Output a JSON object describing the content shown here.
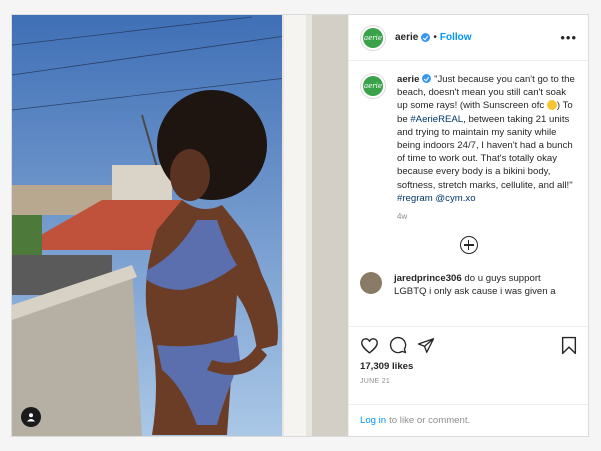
{
  "colors": {
    "accent": "#0095f6",
    "brand_green": "#3aa34a",
    "verified": "#3897f0"
  },
  "account": {
    "username": "aerie",
    "avatar_text": "aerie",
    "follow_label": "Follow",
    "separator": "•",
    "more_label": "•••"
  },
  "caption": {
    "username": "aerie",
    "part1": "\"Just because you can't go to the beach, doesn't mean you still can't soak up some rays! (with Sunscreen ofc ",
    "part2": ") To be ",
    "hashtag1": "#AerieREAL",
    "part3": ", between taking 21 units and trying to maintain my sanity while being indoors 24/7, I haven't had a bunch of time to work out. That's totally okay because every body is a bikini body, softness, stretch marks, cellulite, and all!\" ",
    "hashtag2": "#regram",
    "mention": "@cym.xo",
    "time_ago": "4w"
  },
  "comment": {
    "username": "jaredprince306",
    "text": "do u guys support LGBTQ i only ask cause i was given a"
  },
  "actions": {
    "icons": [
      "heart-icon",
      "comment-icon",
      "share-icon",
      "bookmark-icon"
    ]
  },
  "likes": "17,309 likes",
  "date": "JUNE 21",
  "login": {
    "link": "Log in",
    "text": "to like or comment."
  }
}
